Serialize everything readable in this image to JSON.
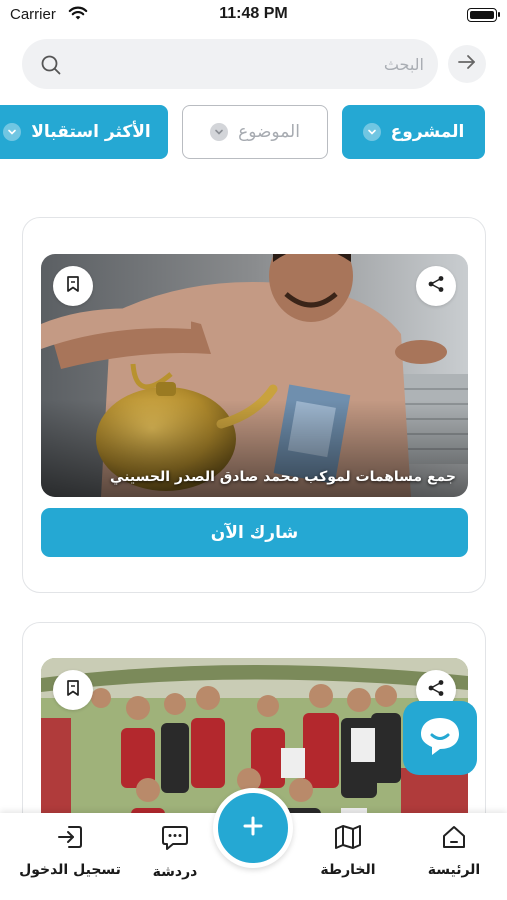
{
  "status_bar": {
    "carrier": "Carrier",
    "time": "11:48 PM"
  },
  "search": {
    "placeholder": "البحث",
    "value": ""
  },
  "filters": [
    {
      "label": "المشروع",
      "style": "filled"
    },
    {
      "label": "الموضوع",
      "style": "outline"
    },
    {
      "label": "الأكثر استقبالا",
      "style": "filled"
    }
  ],
  "cards": [
    {
      "caption": "جمع مساهمات لموكب محمد صادق الصدر الحسيني",
      "cta_label": "شارك الآن"
    },
    {
      "caption": "",
      "cta_label": ""
    }
  ],
  "bottom_nav": {
    "items": [
      {
        "label": "الرئيسة",
        "icon": "home-icon"
      },
      {
        "label": "الخارطة",
        "icon": "map-icon"
      },
      {
        "label": "دردشة",
        "icon": "chat-icon"
      },
      {
        "label": "تسجيل الدخول",
        "icon": "login-icon"
      }
    ],
    "center_action": "plus-icon"
  },
  "colors": {
    "accent": "#25a8d3",
    "background": "#ffffff",
    "search_bg": "#f0f1f3",
    "card_border": "#e2e4e7"
  }
}
